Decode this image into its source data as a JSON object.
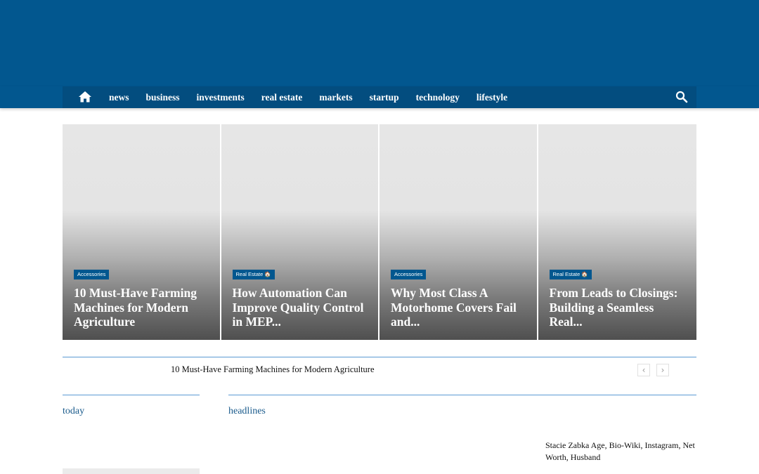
{
  "nav": {
    "items": [
      {
        "label": "news"
      },
      {
        "label": "business"
      },
      {
        "label": "investments"
      },
      {
        "label": "real estate"
      },
      {
        "label": "markets"
      },
      {
        "label": "startup"
      },
      {
        "label": "technology"
      },
      {
        "label": "lifestyle"
      }
    ],
    "home_icon": "home-icon",
    "search_icon": "search-icon"
  },
  "featured": [
    {
      "category": "Accessories",
      "title": "10 Must-Have Farming Machines for Modern Agriculture"
    },
    {
      "category": "Real Estate 🏠",
      "title": "How Automation Can Improve Quality Control in MEP..."
    },
    {
      "category": "Accessories",
      "title": "Why Most Class A Motorhome Covers Fail and..."
    },
    {
      "category": "Real Estate 🏠",
      "title": "From Leads to Closings: Building a Seamless Real..."
    }
  ],
  "ticker": {
    "headline": "10 Must-Have Farming Machines for Modern Agriculture",
    "prev_label": "‹",
    "next_label": "›"
  },
  "sections": {
    "today": "today",
    "headlines": "headlines"
  },
  "side_article": {
    "title": "Stacie Zabka Age, Bio-Wiki, Instagram, Net Worth, Husband"
  },
  "colors": {
    "header": "#02578f",
    "nav_inner": "#034d7f",
    "accent_line": "#5a9ad3",
    "section_title": "#1a5b8c"
  }
}
